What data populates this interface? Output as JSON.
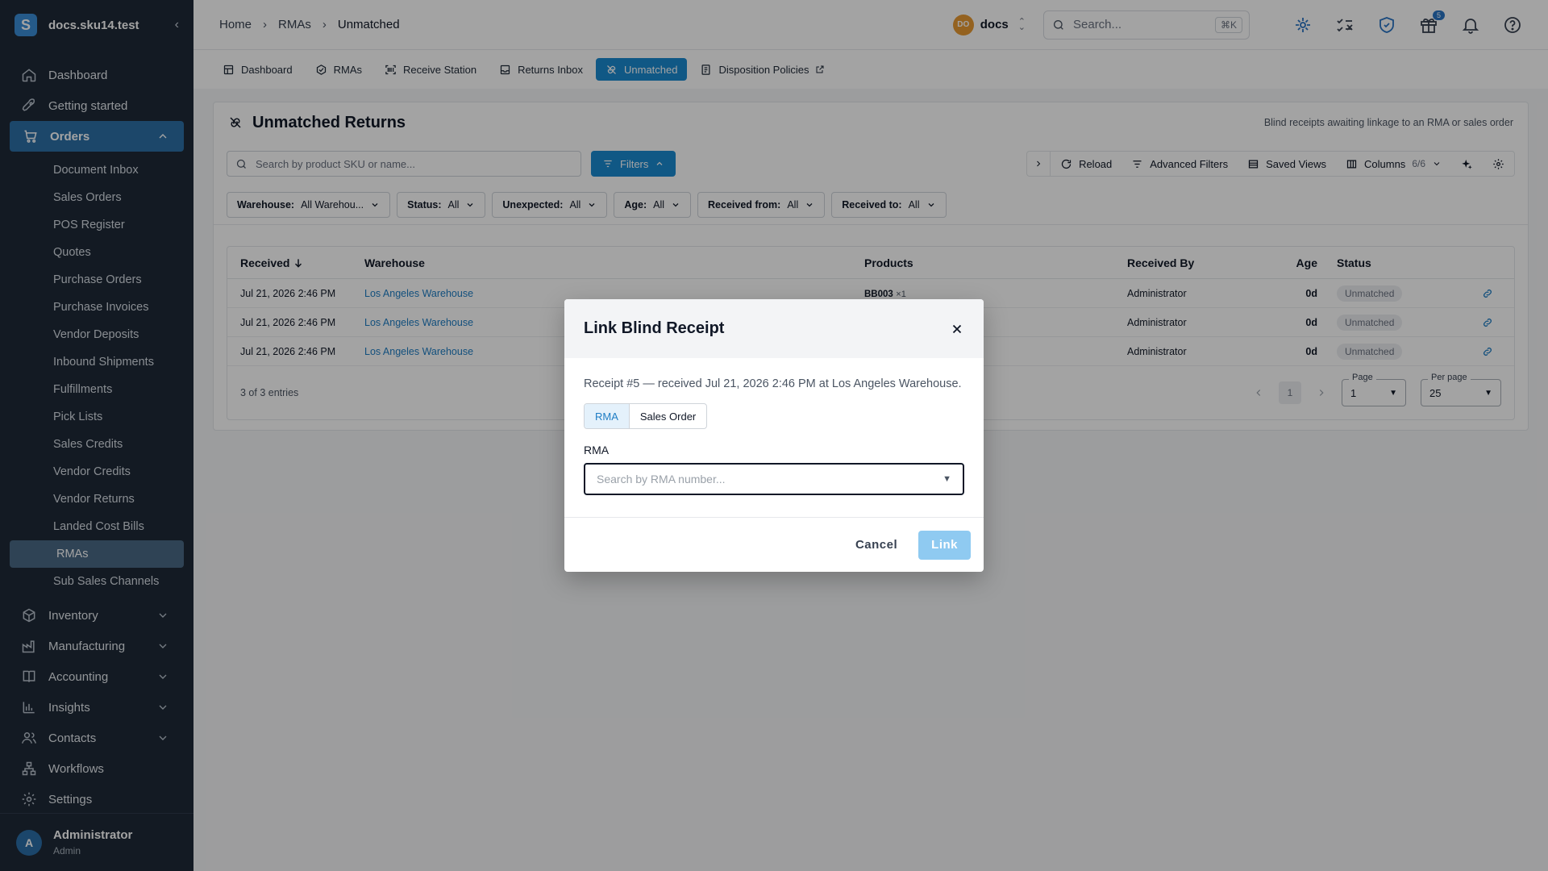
{
  "app": {
    "workspace_domain": "docs.sku14.test",
    "logo_letter": "S"
  },
  "sidebar": {
    "items": [
      {
        "label": "Dashboard",
        "icon": "home-icon"
      },
      {
        "label": "Getting started",
        "icon": "rocket-icon"
      },
      {
        "label": "Orders",
        "icon": "cart-icon",
        "expanded": true,
        "active": true
      }
    ],
    "orders_sub": [
      {
        "label": "Document Inbox"
      },
      {
        "label": "Sales Orders"
      },
      {
        "label": "POS Register"
      },
      {
        "label": "Quotes"
      },
      {
        "label": "Purchase Orders"
      },
      {
        "label": "Purchase Invoices"
      },
      {
        "label": "Vendor Deposits"
      },
      {
        "label": "Inbound Shipments"
      },
      {
        "label": "Fulfillments"
      },
      {
        "label": "Pick Lists"
      },
      {
        "label": "Sales Credits"
      },
      {
        "label": "Vendor Credits"
      },
      {
        "label": "Vendor Returns"
      },
      {
        "label": "Landed Cost Bills"
      },
      {
        "label": "RMAs",
        "selected": true
      },
      {
        "label": "Sub Sales Channels"
      }
    ],
    "items_after": [
      {
        "label": "Inventory",
        "icon": "box-icon"
      },
      {
        "label": "Manufacturing",
        "icon": "factory-icon"
      },
      {
        "label": "Accounting",
        "icon": "book-icon"
      },
      {
        "label": "Insights",
        "icon": "bar-chart-icon"
      },
      {
        "label": "Contacts",
        "icon": "contacts-icon"
      },
      {
        "label": "Workflows",
        "icon": "workflow-icon"
      },
      {
        "label": "Settings",
        "icon": "gear-icon"
      }
    ],
    "user": {
      "initial": "A",
      "name": "Administrator",
      "role": "Admin"
    }
  },
  "topbar": {
    "breadcrumb": [
      "Home",
      "RMAs",
      "Unmatched"
    ],
    "workspace": {
      "initials": "DO",
      "name": "docs"
    },
    "search_placeholder": "Search...",
    "search_shortcut": "⌘K",
    "gift_badge": "5"
  },
  "tabs": [
    {
      "label": "Dashboard",
      "icon": "dashboard-icon"
    },
    {
      "label": "RMAs",
      "icon": "rma-icon"
    },
    {
      "label": "Receive Station",
      "icon": "scan-icon"
    },
    {
      "label": "Returns Inbox",
      "icon": "inbox-icon"
    },
    {
      "label": "Unmatched",
      "icon": "unlink-icon",
      "active": true
    },
    {
      "label": "Disposition Policies",
      "icon": "policy-icon",
      "external": true
    }
  ],
  "card": {
    "title": "Unmatched Returns",
    "subtitle": "Blind receipts awaiting linkage to an RMA or sales order",
    "search_placeholder": "Search by product SKU or name...",
    "filters_label": "Filters",
    "tools": {
      "reload": "Reload",
      "advanced": "Advanced Filters",
      "saved": "Saved Views",
      "columns": "Columns",
      "columns_count": "6/6"
    },
    "chips": [
      {
        "key": "Warehouse:",
        "value": "All Warehou..."
      },
      {
        "key": "Status:",
        "value": "All"
      },
      {
        "key": "Unexpected:",
        "value": "All"
      },
      {
        "key": "Age:",
        "value": "All"
      },
      {
        "key": "Received from:",
        "value": "All"
      },
      {
        "key": "Received to:",
        "value": "All"
      }
    ],
    "columns": [
      "Received",
      "Warehouse",
      "Products",
      "Received By",
      "Age",
      "Status"
    ],
    "rows": [
      {
        "received": "Jul 21, 2026 2:46 PM",
        "warehouse": "Los Angeles Warehouse",
        "product": "BB003",
        "qty": "×1",
        "by": "Administrator",
        "age": "0d",
        "status": "Unmatched"
      },
      {
        "received": "Jul 21, 2026 2:46 PM",
        "warehouse": "Los Angeles Warehouse",
        "product": "",
        "qty": "",
        "by": "Administrator",
        "age": "0d",
        "status": "Unmatched"
      },
      {
        "received": "Jul 21, 2026 2:46 PM",
        "warehouse": "Los Angeles Warehouse",
        "product": "",
        "qty": "",
        "by": "Administrator",
        "age": "0d",
        "status": "Unmatched"
      }
    ],
    "entries": "3 of 3 entries",
    "current_page": "1",
    "page_label": "Page",
    "page_value": "1",
    "per_page_label": "Per page",
    "per_page_value": "25"
  },
  "dialog": {
    "title": "Link Blind Receipt",
    "description": "Receipt #5 — received Jul 21, 2026 2:46 PM at Los Angeles Warehouse.",
    "segments": [
      "RMA",
      "Sales Order"
    ],
    "field_label": "RMA",
    "field_placeholder": "Search by RMA number...",
    "cancel": "Cancel",
    "confirm": "Link"
  }
}
